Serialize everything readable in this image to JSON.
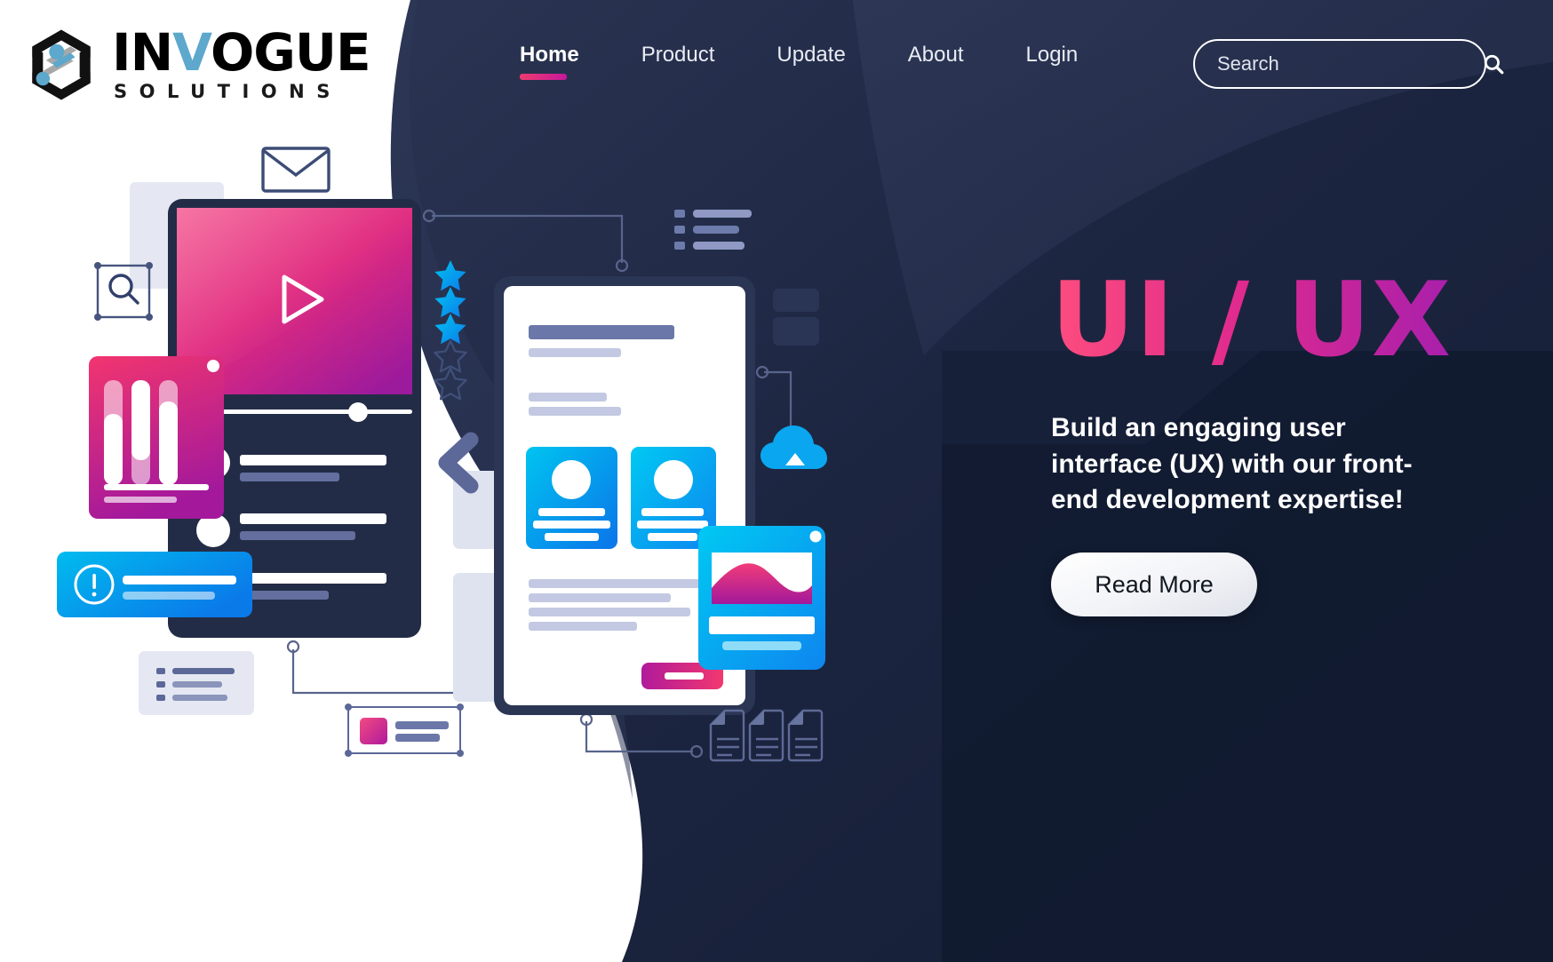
{
  "brand": {
    "name_main": "INVOGUE",
    "name_main_pre": "IN",
    "name_main_v": "V",
    "name_main_post": "OGUE",
    "name_sub": "SOLUTIONS",
    "accent_blue": "#5da8cc"
  },
  "nav": {
    "items": [
      {
        "label": "Home",
        "active": true
      },
      {
        "label": "Product",
        "active": false
      },
      {
        "label": "Update",
        "active": false
      },
      {
        "label": "About",
        "active": false
      },
      {
        "label": "Login",
        "active": false
      }
    ],
    "active_underline_color": "#ef3b6e"
  },
  "search": {
    "placeholder": "Search",
    "value": "",
    "icon": "search-icon"
  },
  "hero": {
    "title": "UI / UX",
    "title_gradient_from": "#fd4d7e",
    "title_gradient_to": "#a41fae",
    "body": "Build an engaging user interface (UX) with our front-end development expertise!",
    "cta_label": "Read More"
  },
  "theme": {
    "page_bg": "#ffffff",
    "dark_navy": "#141e36",
    "dark_navy_light": "#27314c",
    "panel_navy": "#131d33",
    "pink": "#ed2a7b",
    "magenta": "#a3189b",
    "blue_cyan": "#00b6ed",
    "blue": "#0a74e8",
    "slate": "#6b77a8",
    "lavender": "#c3c9e2"
  },
  "illustration": {
    "rating": {
      "filled": 3,
      "total": 5
    },
    "elements": [
      "envelope-icon",
      "magnifier-frame-icon",
      "tablet-video-player",
      "pink-bar-chart-card",
      "blue-alert-card",
      "list-card",
      "white-tablet-profile",
      "profile-card-left",
      "profile-card-right",
      "blue-chart-widget",
      "cloud-upload-icon",
      "document-icons",
      "star-rating",
      "back-chevron-icon",
      "thumbnail-card"
    ]
  }
}
